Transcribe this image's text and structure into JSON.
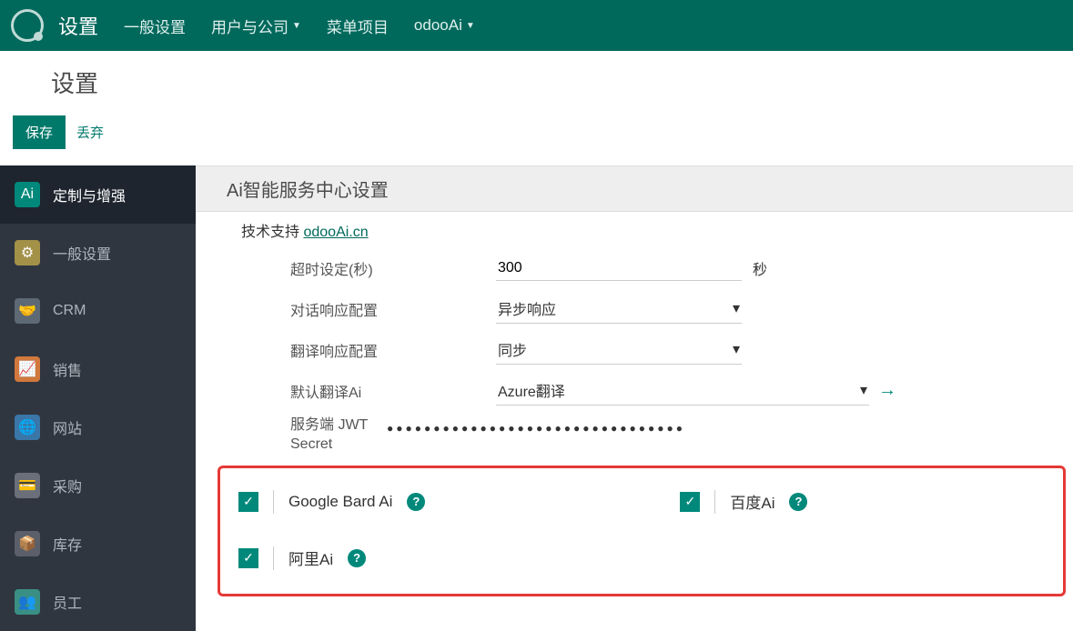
{
  "nav": {
    "title": "设置",
    "items": [
      "一般设置",
      "用户与公司",
      "菜单项目",
      "odooAi"
    ],
    "dropdowns": [
      false,
      true,
      false,
      true
    ]
  },
  "page": {
    "title": "设置",
    "save": "保存",
    "discard": "丢弃"
  },
  "sidebar": [
    {
      "label": "定制与增强",
      "active": true,
      "icon": "Ai",
      "bg": "bg-teal"
    },
    {
      "label": "一般设置",
      "active": false,
      "icon": "⚙",
      "bg": "bg-olive"
    },
    {
      "label": "CRM",
      "active": false,
      "icon": "🤝",
      "bg": "bg-gray"
    },
    {
      "label": "销售",
      "active": false,
      "icon": "📈",
      "bg": "bg-orange"
    },
    {
      "label": "网站",
      "active": false,
      "icon": "🌐",
      "bg": "bg-blue"
    },
    {
      "label": "采购",
      "active": false,
      "icon": "💳",
      "bg": "bg-gray2"
    },
    {
      "label": "库存",
      "active": false,
      "icon": "📦",
      "bg": "bg-gray3"
    },
    {
      "label": "员工",
      "active": false,
      "icon": "👥",
      "bg": "bg-teal2"
    }
  ],
  "section": {
    "title": "Ai智能服务中心设置",
    "tech_label": "技术支持",
    "tech_link": "odooAi.cn"
  },
  "form": {
    "timeout_label": "超时设定(秒)",
    "timeout_value": "300",
    "timeout_unit": "秒",
    "chat_resp_label": "对话响应配置",
    "chat_resp_value": "异步响应",
    "trans_resp_label": "翻译响应配置",
    "trans_resp_value": "同步",
    "default_trans_label": "默认翻译Ai",
    "default_trans_value": "Azure翻译",
    "jwt_label_1": "服务端 JWT",
    "jwt_label_2": "Secret",
    "jwt_value": "●●●●●●●●●●●●●●●●●●●●●●●●●●●●●●●●"
  },
  "checks": {
    "google": "Google Bard Ai",
    "baidu": "百度Ai",
    "ali": "阿里Ai"
  }
}
